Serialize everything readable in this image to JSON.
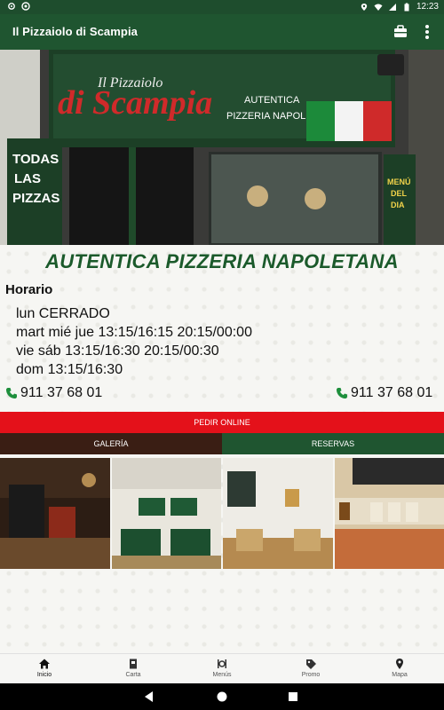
{
  "status_bar": {
    "time": "12:23",
    "icons": [
      "settings-icon",
      "android-icon",
      "location-icon",
      "wifi-icon",
      "signal-icon",
      "battery-icon"
    ]
  },
  "app_bar": {
    "title": "Il Pizzaiolo di Scampia",
    "actions": [
      "briefcase-icon"
    ]
  },
  "hero": {
    "sign_small": "Il Pizzaiolo",
    "sign_logo": "di Scampia",
    "sign_text": [
      "AUTENTICA",
      "PIZZERIA NAPOLETANA"
    ],
    "side_banner_left": [
      "TODAS",
      "LAS",
      "PIZZAS"
    ],
    "side_banner_right": [
      "MENÚ",
      "DEL",
      "DIA"
    ]
  },
  "headline": "AUTENTICA PIZZERIA NAPOLETANA",
  "schedule": {
    "title": "Horario",
    "lines": [
      "lun CERRADO",
      "mart mié jue 13:15/16:15 20:15/00:00",
      "vie sáb 13:15/16:30 20:15/00:30",
      "dom 13:15/16:30"
    ]
  },
  "phones": [
    "911 37 68 01",
    "911 37 68 01"
  ],
  "buttons": {
    "online": "PEDIR ONLINE",
    "gallery": "GALERÍA",
    "reservations": "RESERVAS"
  },
  "colors": {
    "primary": "#1f5530",
    "online": "#e4111a",
    "gallery_tab": "#3a1e14",
    "reserve_tab": "#1f5530",
    "headline": "#1b5a2b"
  },
  "bottom_nav": [
    {
      "label": "Inicio",
      "icon": "home-icon",
      "active": true
    },
    {
      "label": "Carta",
      "icon": "menu-book-icon",
      "active": false
    },
    {
      "label": "Menús",
      "icon": "cutlery-icon",
      "active": false
    },
    {
      "label": "Promo",
      "icon": "tag-icon",
      "active": false
    },
    {
      "label": "Mapa",
      "icon": "map-pin-icon",
      "active": false
    }
  ]
}
